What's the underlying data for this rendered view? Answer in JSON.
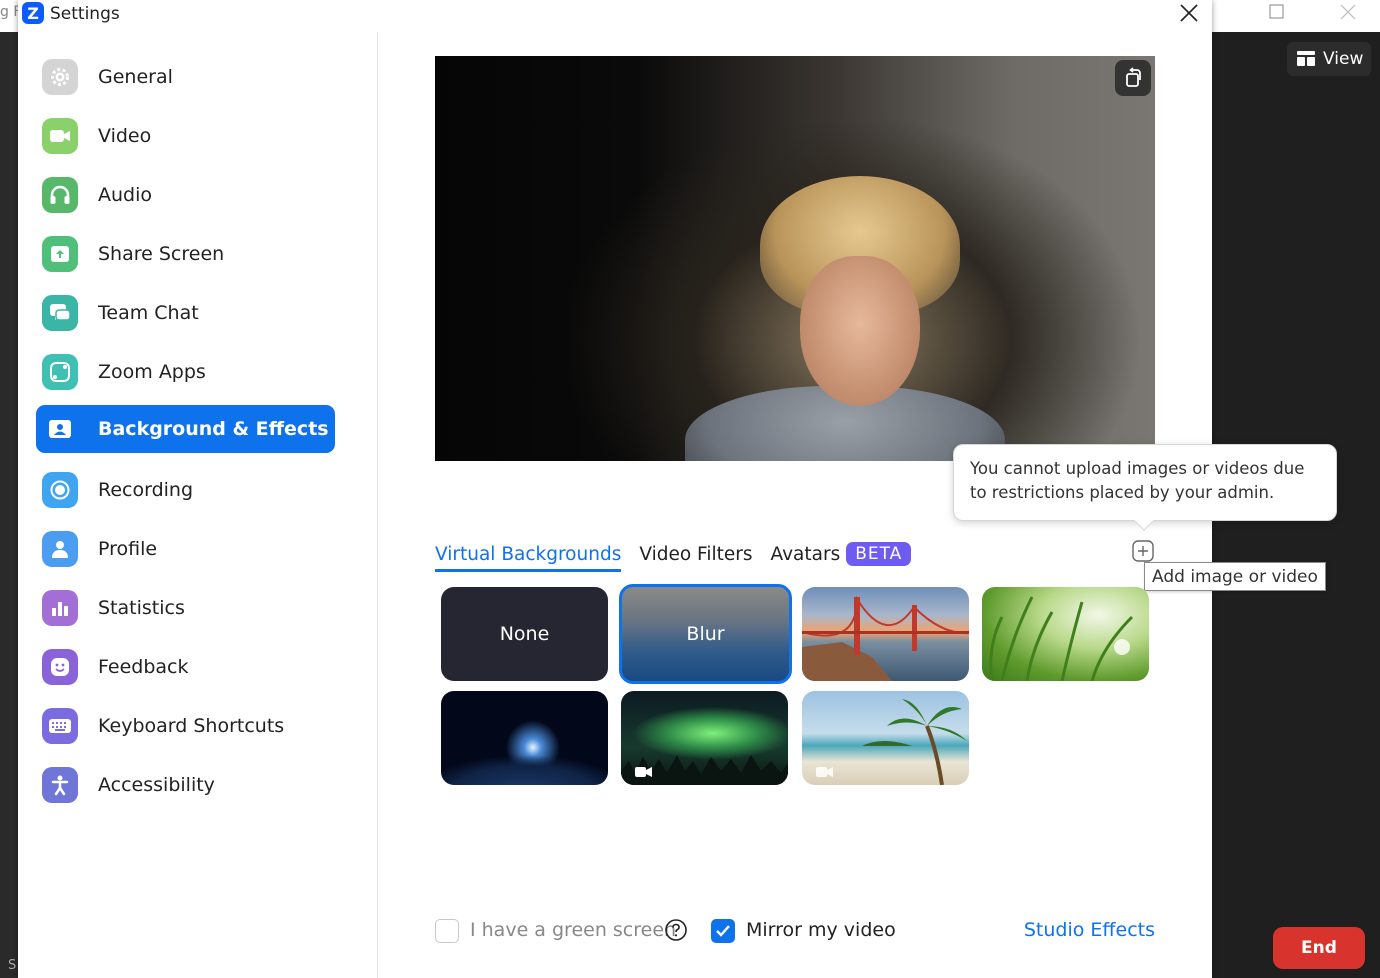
{
  "background_window": {
    "left_text": "g F",
    "bottom_left_text": "S",
    "view_label": "View",
    "end_label": "End"
  },
  "settings": {
    "title": "Settings",
    "logo_letter": "Z"
  },
  "sidebar": {
    "items": [
      {
        "label": "General",
        "icon": "gear-icon",
        "color": "#c9c9c9"
      },
      {
        "label": "Video",
        "icon": "camera-icon",
        "color": "#8bd16b"
      },
      {
        "label": "Audio",
        "icon": "headphones-icon",
        "color": "#58b86a"
      },
      {
        "label": "Share Screen",
        "icon": "share-screen-icon",
        "color": "#4fbf7a"
      },
      {
        "label": "Team Chat",
        "icon": "chat-icon",
        "color": "#3bb5a5"
      },
      {
        "label": "Zoom Apps",
        "icon": "apps-icon",
        "color": "#3fc0b3"
      },
      {
        "label": "Background & Effects",
        "icon": "background-icon",
        "color": "#ffffff",
        "active": true
      },
      {
        "label": "Recording",
        "icon": "record-icon",
        "color": "#3fa5f0"
      },
      {
        "label": "Profile",
        "icon": "profile-icon",
        "color": "#4b9df2"
      },
      {
        "label": "Statistics",
        "icon": "statistics-icon",
        "color": "#a36fd6"
      },
      {
        "label": "Feedback",
        "icon": "feedback-icon",
        "color": "#8b63d9"
      },
      {
        "label": "Keyboard Shortcuts",
        "icon": "keyboard-icon",
        "color": "#7a6be0"
      },
      {
        "label": "Accessibility",
        "icon": "accessibility-icon",
        "color": "#6f76d8"
      }
    ]
  },
  "main": {
    "tooltip": "You cannot upload images or videos due to restrictions placed by your admin.",
    "tabs": [
      {
        "label": "Virtual Backgrounds",
        "active": true
      },
      {
        "label": "Video Filters"
      },
      {
        "label": "Avatars",
        "badge": "BETA"
      }
    ],
    "add_tooltip": "Add image or video",
    "backgrounds": [
      {
        "label": "None"
      },
      {
        "label": "Blur",
        "selected": true
      },
      {
        "label": ""
      },
      {
        "label": ""
      },
      {
        "label": ""
      },
      {
        "label": "",
        "video": true
      },
      {
        "label": "",
        "video": true
      }
    ],
    "green_screen_label": "I have a green screen",
    "green_screen_checked": false,
    "mirror_label": "Mirror my video",
    "mirror_checked": true,
    "studio_effects": "Studio Effects"
  },
  "colors": {
    "accent": "#0e72ed",
    "beta": "#6e5bf0",
    "end": "#d8332c"
  }
}
